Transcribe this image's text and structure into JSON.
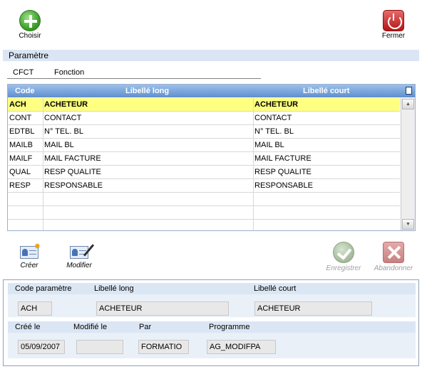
{
  "toolbar": {
    "choisir_label": "Choisir",
    "fermer_label": "Fermer"
  },
  "section": {
    "title": "Paramètre"
  },
  "param": {
    "code": "CFCT",
    "name": "Fonction"
  },
  "grid": {
    "columns": [
      "Code",
      "Libellé long",
      "Libellé court"
    ],
    "rows": [
      {
        "code": "ACH",
        "long": "ACHETEUR",
        "court": "ACHETEUR",
        "selected": true
      },
      {
        "code": "CONT",
        "long": "CONTACT",
        "court": "CONTACT"
      },
      {
        "code": "EDTBL",
        "long": "N° TEL. BL",
        "court": "N° TEL. BL"
      },
      {
        "code": "MAILB",
        "long": "MAIL BL",
        "court": "MAIL BL"
      },
      {
        "code": "MAILF",
        "long": "MAIL FACTURE",
        "court": "MAIL FACTURE"
      },
      {
        "code": "QUAL",
        "long": "RESP QUALITE",
        "court": "RESP QUALITE"
      },
      {
        "code": "RESP",
        "long": "RESPONSABLE",
        "court": "RESPONSABLE"
      }
    ]
  },
  "actions": {
    "creer": "Créer",
    "modifier": "Modifier",
    "enregistrer": "Enregistrer",
    "abandonner": "Abandonner"
  },
  "detail": {
    "labels": {
      "code": "Code paramètre",
      "long": "Libellé long",
      "court": "Libellé court",
      "cree": "Créé le",
      "modifie": "Modifié le",
      "par": "Par",
      "programme": "Programme"
    },
    "values": {
      "code": "ACH",
      "long": "ACHETEUR",
      "court": "ACHETEUR",
      "cree": "05/09/2007",
      "modifie": "",
      "par": "FORMATIO",
      "programme": "AG_MODIFPA"
    }
  }
}
